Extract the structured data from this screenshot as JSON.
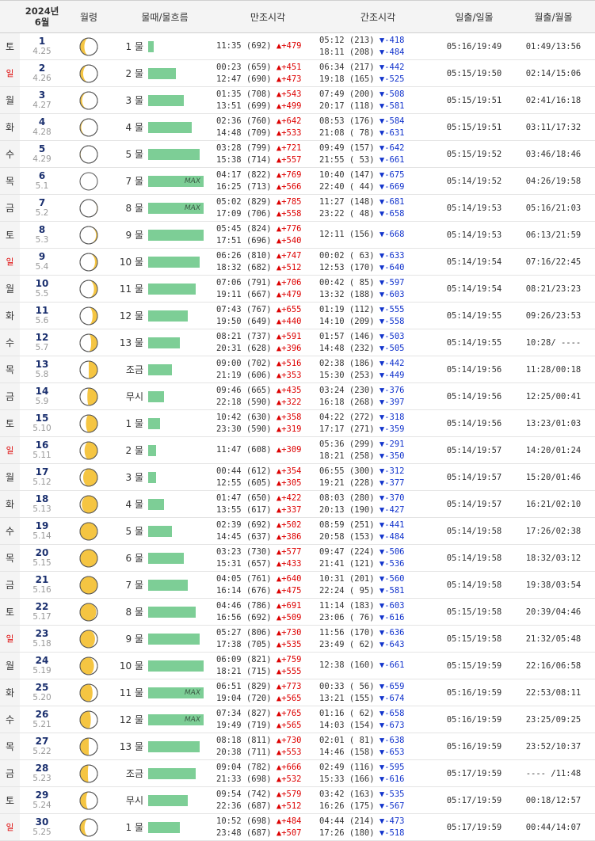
{
  "header": {
    "year": "2024년",
    "month": "6월",
    "moon": "월령",
    "tide": "물때/물흐름",
    "high": "만조시각",
    "low": "간조시각",
    "sun": "일출/일몰",
    "moonrise": "월출/월몰"
  },
  "max_label": "MAX",
  "rows": [
    {
      "dow": "토",
      "day": "1",
      "lunar": "4.25",
      "mul": "1 물",
      "bar": 0.1,
      "max": false,
      "h1": "11:35 (692)",
      "h1d": "▲+479",
      "h2": "",
      "h2d": "",
      "l1": "05:12 (213)",
      "l1d": "▼-418",
      "l2": "18:11 (208)",
      "l2d": "▼-484",
      "sun": "05:16/19:49",
      "mn": "01:49/13:56",
      "phase": "crescent-waning",
      "illum": 0.25
    },
    {
      "dow": "일",
      "day": "2",
      "lunar": "4.26",
      "mul": "2 물",
      "bar": 0.5,
      "max": false,
      "h1": "00:23 (659)",
      "h1d": "▲+451",
      "h2": "12:47 (690)",
      "h2d": "▲+473",
      "l1": "06:34 (217)",
      "l1d": "▼-442",
      "l2": "19:18 (165)",
      "l2d": "▼-525",
      "sun": "05:15/19:50",
      "mn": "02:14/15:06",
      "phase": "crescent-waning",
      "illum": 0.18
    },
    {
      "dow": "월",
      "day": "3",
      "lunar": "4.27",
      "mul": "3 물",
      "bar": 0.64,
      "max": false,
      "h1": "01:35 (708)",
      "h1d": "▲+543",
      "h2": "13:51 (699)",
      "h2d": "▲+499",
      "l1": "07:49 (200)",
      "l1d": "▼-508",
      "l2": "20:17 (118)",
      "l2d": "▼-581",
      "sun": "05:15/19:51",
      "mn": "02:41/16:18",
      "phase": "crescent-waning",
      "illum": 0.12
    },
    {
      "dow": "화",
      "day": "4",
      "lunar": "4.28",
      "mul": "4 물",
      "bar": 0.79,
      "max": false,
      "h1": "02:36 (760)",
      "h1d": "▲+642",
      "h2": "14:48 (709)",
      "h2d": "▲+533",
      "l1": "08:53 (176)",
      "l1d": "▼-584",
      "l2": "21:08 ( 78)",
      "l2d": "▼-631",
      "sun": "05:15/19:51",
      "mn": "03:11/17:32",
      "phase": "crescent-waning",
      "illum": 0.07
    },
    {
      "dow": "수",
      "day": "5",
      "lunar": "4.29",
      "mul": "5 물",
      "bar": 0.93,
      "max": false,
      "h1": "03:28 (799)",
      "h1d": "▲+721",
      "h2": "15:38 (714)",
      "h2d": "▲+557",
      "l1": "09:49 (157)",
      "l1d": "▼-642",
      "l2": "21:55 ( 53)",
      "l2d": "▼-661",
      "sun": "05:15/19:52",
      "mn": "03:46/18:46",
      "phase": "crescent-waning",
      "illum": 0.03
    },
    {
      "dow": "목",
      "day": "6",
      "lunar": "5.1",
      "mul": "7 물",
      "bar": 1.0,
      "max": true,
      "h1": "04:17 (822)",
      "h1d": "▲+769",
      "h2": "16:25 (713)",
      "h2d": "▲+566",
      "l1": "10:40 (147)",
      "l1d": "▼-675",
      "l2": "22:40 ( 44)",
      "l2d": "▼-669",
      "sun": "05:14/19:52",
      "mn": "04:26/19:58",
      "phase": "new",
      "illum": 0.0
    },
    {
      "dow": "금",
      "day": "7",
      "lunar": "5.2",
      "mul": "8 물",
      "bar": 1.0,
      "max": true,
      "h1": "05:02 (829)",
      "h1d": "▲+785",
      "h2": "17:09 (706)",
      "h2d": "▲+558",
      "l1": "11:27 (148)",
      "l1d": "▼-681",
      "l2": "23:22 ( 48)",
      "l2d": "▼-658",
      "sun": "05:14/19:53",
      "mn": "05:16/21:03",
      "phase": "crescent-waxing",
      "illum": 0.03
    },
    {
      "dow": "토",
      "day": "8",
      "lunar": "5.3",
      "mul": "9 물",
      "bar": 1.0,
      "max": false,
      "h1": "05:45 (824)",
      "h1d": "▲+776",
      "h2": "17:51 (696)",
      "h2d": "▲+540",
      "l1": "12:11 (156)",
      "l1d": "▼-668",
      "l2": "",
      "l2d": "",
      "sun": "05:14/19:53",
      "mn": "06:13/21:59",
      "phase": "crescent-waxing",
      "illum": 0.08
    },
    {
      "dow": "일",
      "day": "9",
      "lunar": "5.4",
      "mul": "10 물",
      "bar": 0.93,
      "max": false,
      "h1": "06:26 (810)",
      "h1d": "▲+747",
      "h2": "18:32 (682)",
      "h2d": "▲+512",
      "l1": "00:02 ( 63)",
      "l1d": "▼-633",
      "l2": "12:53 (170)",
      "l2d": "▼-640",
      "sun": "05:14/19:54",
      "mn": "07:16/22:45",
      "phase": "crescent-waxing",
      "illum": 0.14
    },
    {
      "dow": "월",
      "day": "10",
      "lunar": "5.5",
      "mul": "11 물",
      "bar": 0.86,
      "max": false,
      "h1": "07:06 (791)",
      "h1d": "▲+706",
      "h2": "19:11 (667)",
      "h2d": "▲+479",
      "l1": "00:42 ( 85)",
      "l1d": "▼-597",
      "l2": "13:32 (188)",
      "l2d": "▼-603",
      "sun": "05:14/19:54",
      "mn": "08:21/23:23",
      "phase": "crescent-waxing",
      "illum": 0.2
    },
    {
      "dow": "화",
      "day": "11",
      "lunar": "5.6",
      "mul": "12 물",
      "bar": 0.71,
      "max": false,
      "h1": "07:43 (767)",
      "h1d": "▲+655",
      "h2": "19:50 (649)",
      "h2d": "▲+440",
      "l1": "01:19 (112)",
      "l1d": "▼-555",
      "l2": "14:10 (209)",
      "l2d": "▼-558",
      "sun": "05:14/19:55",
      "mn": "09:26/23:53",
      "phase": "crescent-waxing",
      "illum": 0.28
    },
    {
      "dow": "수",
      "day": "12",
      "lunar": "5.7",
      "mul": "13 물",
      "bar": 0.57,
      "max": false,
      "h1": "08:21 (737)",
      "h1d": "▲+591",
      "h2": "20:31 (628)",
      "h2d": "▲+396",
      "l1": "01:57 (146)",
      "l1d": "▼-503",
      "l2": "14:48 (232)",
      "l2d": "▼-505",
      "sun": "05:14/19:55",
      "mn": "10:28/ ----",
      "phase": "crescent-waxing",
      "illum": 0.36
    },
    {
      "dow": "목",
      "day": "13",
      "lunar": "5.8",
      "mul": "조금",
      "bar": 0.43,
      "max": false,
      "h1": "09:00 (702)",
      "h1d": "▲+516",
      "h2": "21:19 (606)",
      "h2d": "▲+353",
      "l1": "02:38 (186)",
      "l1d": "▼-442",
      "l2": "15:30 (253)",
      "l2d": "▼-449",
      "sun": "05:14/19:56",
      "mn": "11:28/00:18",
      "phase": "quarter",
      "illum": 0.5
    },
    {
      "dow": "금",
      "day": "14",
      "lunar": "5.9",
      "mul": "무시",
      "bar": 0.29,
      "max": false,
      "h1": "09:46 (665)",
      "h1d": "▲+435",
      "h2": "22:18 (590)",
      "h2d": "▲+322",
      "l1": "03:24 (230)",
      "l1d": "▼-376",
      "l2": "16:18 (268)",
      "l2d": "▼-397",
      "sun": "05:14/19:56",
      "mn": "12:25/00:41",
      "phase": "gibbous-waxing",
      "illum": 0.58
    },
    {
      "dow": "토",
      "day": "15",
      "lunar": "5.10",
      "mul": "1 물",
      "bar": 0.21,
      "max": false,
      "h1": "10:42 (630)",
      "h1d": "▲+358",
      "h2": "23:30 (590)",
      "h2d": "▲+319",
      "l1": "04:22 (272)",
      "l1d": "▼-318",
      "l2": "17:17 (271)",
      "l2d": "▼-359",
      "sun": "05:14/19:56",
      "mn": "13:23/01:03",
      "phase": "gibbous-waxing",
      "illum": 0.66
    },
    {
      "dow": "일",
      "day": "16",
      "lunar": "5.11",
      "mul": "2 물",
      "bar": 0.14,
      "max": false,
      "h1": "11:47 (608)",
      "h1d": "▲+309",
      "h2": "",
      "h2d": "",
      "l1": "05:36 (299)",
      "l1d": "▼-291",
      "l2": "18:21 (258)",
      "l2d": "▼-350",
      "sun": "05:14/19:57",
      "mn": "14:20/01:24",
      "phase": "gibbous-waxing",
      "illum": 0.74
    },
    {
      "dow": "월",
      "day": "17",
      "lunar": "5.12",
      "mul": "3 물",
      "bar": 0.14,
      "max": false,
      "h1": "00:44 (612)",
      "h1d": "▲+354",
      "h2": "12:55 (605)",
      "h2d": "▲+305",
      "l1": "06:55 (300)",
      "l1d": "▼-312",
      "l2": "19:21 (228)",
      "l2d": "▼-377",
      "sun": "05:14/19:57",
      "mn": "15:20/01:46",
      "phase": "gibbous-waxing",
      "illum": 0.82
    },
    {
      "dow": "화",
      "day": "18",
      "lunar": "5.13",
      "mul": "4 물",
      "bar": 0.29,
      "max": false,
      "h1": "01:47 (650)",
      "h1d": "▲+422",
      "h2": "13:55 (617)",
      "h2d": "▲+337",
      "l1": "08:03 (280)",
      "l1d": "▼-370",
      "l2": "20:13 (190)",
      "l2d": "▼-427",
      "sun": "05:14/19:57",
      "mn": "16:21/02:10",
      "phase": "gibbous-waxing",
      "illum": 0.9
    },
    {
      "dow": "수",
      "day": "19",
      "lunar": "5.14",
      "mul": "5 물",
      "bar": 0.43,
      "max": false,
      "h1": "02:39 (692)",
      "h1d": "▲+502",
      "h2": "14:45 (637)",
      "h2d": "▲+386",
      "l1": "08:59 (251)",
      "l1d": "▼-441",
      "l2": "20:58 (153)",
      "l2d": "▼-484",
      "sun": "05:14/19:58",
      "mn": "17:26/02:38",
      "phase": "full",
      "illum": 0.97
    },
    {
      "dow": "목",
      "day": "20",
      "lunar": "5.15",
      "mul": "6 물",
      "bar": 0.64,
      "max": false,
      "h1": "03:23 (730)",
      "h1d": "▲+577",
      "h2": "15:31 (657)",
      "h2d": "▲+433",
      "l1": "09:47 (224)",
      "l1d": "▼-506",
      "l2": "21:41 (121)",
      "l2d": "▼-536",
      "sun": "05:14/19:58",
      "mn": "18:32/03:12",
      "phase": "full",
      "illum": 1.0
    },
    {
      "dow": "금",
      "day": "21",
      "lunar": "5.16",
      "mul": "7 물",
      "bar": 0.71,
      "max": false,
      "h1": "04:05 (761)",
      "h1d": "▲+640",
      "h2": "16:14 (676)",
      "h2d": "▲+475",
      "l1": "10:31 (201)",
      "l1d": "▼-560",
      "l2": "22:24 ( 95)",
      "l2d": "▼-581",
      "sun": "05:14/19:58",
      "mn": "19:38/03:54",
      "phase": "full",
      "illum": 0.98
    },
    {
      "dow": "토",
      "day": "22",
      "lunar": "5.17",
      "mul": "8 물",
      "bar": 0.86,
      "max": false,
      "h1": "04:46 (786)",
      "h1d": "▲+691",
      "h2": "16:56 (692)",
      "h2d": "▲+509",
      "l1": "11:14 (183)",
      "l1d": "▼-603",
      "l2": "23:06 ( 76)",
      "l2d": "▼-616",
      "sun": "05:15/19:58",
      "mn": "20:39/04:46",
      "phase": "gibbous-waning",
      "illum": 0.93
    },
    {
      "dow": "일",
      "day": "23",
      "lunar": "5.18",
      "mul": "9 물",
      "bar": 0.93,
      "max": false,
      "h1": "05:27 (806)",
      "h1d": "▲+730",
      "h2": "17:38 (705)",
      "h2d": "▲+535",
      "l1": "11:56 (170)",
      "l1d": "▼-636",
      "l2": "23:49 ( 62)",
      "l2d": "▼-643",
      "sun": "05:15/19:58",
      "mn": "21:32/05:48",
      "phase": "gibbous-waning",
      "illum": 0.86
    },
    {
      "dow": "월",
      "day": "24",
      "lunar": "5.19",
      "mul": "10 물",
      "bar": 1.0,
      "max": false,
      "h1": "06:09 (821)",
      "h1d": "▲+759",
      "h2": "18:21 (715)",
      "h2d": "▲+555",
      "l1": "12:38 (160)",
      "l1d": "▼-661",
      "l2": "",
      "l2d": "",
      "sun": "05:15/19:59",
      "mn": "22:16/06:58",
      "phase": "gibbous-waning",
      "illum": 0.8
    },
    {
      "dow": "화",
      "day": "25",
      "lunar": "5.20",
      "mul": "11 물",
      "bar": 1.0,
      "max": true,
      "h1": "06:51 (829)",
      "h1d": "▲+773",
      "h2": "19:04 (720)",
      "h2d": "▲+565",
      "l1": "00:33 ( 56)",
      "l1d": "▼-659",
      "l2": "13:21 (155)",
      "l2d": "▼-674",
      "sun": "05:16/19:59",
      "mn": "22:53/08:11",
      "phase": "gibbous-waning",
      "illum": 0.72
    },
    {
      "dow": "수",
      "day": "26",
      "lunar": "5.21",
      "mul": "12 물",
      "bar": 1.0,
      "max": true,
      "h1": "07:34 (827)",
      "h1d": "▲+765",
      "h2": "19:49 (719)",
      "h2d": "▲+565",
      "l1": "01:16 ( 62)",
      "l1d": "▼-658",
      "l2": "14:03 (154)",
      "l2d": "▼-673",
      "sun": "05:16/19:59",
      "mn": "23:25/09:25",
      "phase": "gibbous-waning",
      "illum": 0.62
    },
    {
      "dow": "목",
      "day": "27",
      "lunar": "5.22",
      "mul": "13 물",
      "bar": 0.93,
      "max": false,
      "h1": "08:18 (811)",
      "h1d": "▲+730",
      "h2": "20:38 (711)",
      "h2d": "▲+553",
      "l1": "02:01 ( 81)",
      "l1d": "▼-638",
      "l2": "14:46 (158)",
      "l2d": "▼-653",
      "sun": "05:16/19:59",
      "mn": "23:52/10:37",
      "phase": "quarter-waning",
      "illum": 0.5
    },
    {
      "dow": "금",
      "day": "28",
      "lunar": "5.23",
      "mul": "조금",
      "bar": 0.86,
      "max": false,
      "h1": "09:04 (782)",
      "h1d": "▲+666",
      "h2": "21:33 (698)",
      "h2d": "▲+532",
      "l1": "02:49 (116)",
      "l1d": "▼-595",
      "l2": "15:33 (166)",
      "l2d": "▼-616",
      "sun": "05:17/19:59",
      "mn": "---- /11:48",
      "phase": "quarter-waning",
      "illum": 0.45
    },
    {
      "dow": "토",
      "day": "29",
      "lunar": "5.24",
      "mul": "무시",
      "bar": 0.71,
      "max": false,
      "h1": "09:54 (742)",
      "h1d": "▲+579",
      "h2": "22:36 (687)",
      "h2d": "▲+512",
      "l1": "03:42 (163)",
      "l1d": "▼-535",
      "l2": "16:26 (175)",
      "l2d": "▼-567",
      "sun": "05:17/19:59",
      "mn": "00:18/12:57",
      "phase": "crescent-waning",
      "illum": 0.35
    },
    {
      "dow": "일",
      "day": "30",
      "lunar": "5.25",
      "mul": "1 물",
      "bar": 0.57,
      "max": false,
      "h1": "10:52 (698)",
      "h1d": "▲+484",
      "h2": "23:48 (687)",
      "h2d": "▲+507",
      "l1": "04:44 (214)",
      "l1d": "▼-473",
      "l2": "17:26 (180)",
      "l2d": "▼-518",
      "sun": "05:17/19:59",
      "mn": "00:44/14:07",
      "phase": "crescent-waning",
      "illum": 0.26
    }
  ],
  "colors": {
    "bar": "#7dce96",
    "moon": "#f5c542",
    "up": "#dd0000",
    "down": "#1133cc",
    "sunday": "#dd0000"
  }
}
